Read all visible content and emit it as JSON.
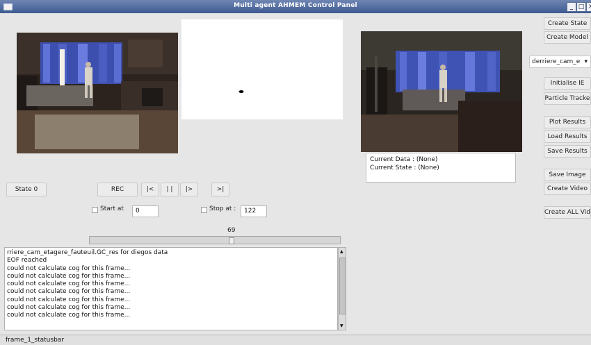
{
  "window": {
    "title": "Multi agent AHMEM Control Panel",
    "min_glyph": "_",
    "max_glyph": "□",
    "close_glyph": "✕"
  },
  "right_panel": {
    "create_state": "Create State",
    "create_model": "Create Model",
    "camera_select_value": "derriere_cam_e",
    "initialise_ie": "Initialise IE",
    "particle_tracker": "Particle Tracke",
    "plot_results": "Plot Results",
    "load_results": "Load Results",
    "save_results": "Save Results",
    "save_image": "Save Image",
    "create_video": "Create Video",
    "create_all_videos": "Create ALL Vid"
  },
  "info": {
    "current_data": "Current Data : (None)",
    "current_state": "Current State : (None)"
  },
  "controls": {
    "state": "State 0",
    "rec": "REC",
    "first": "|<",
    "pause": "| |",
    "play": "|>",
    "last": ">|",
    "start_at_label": "Start at",
    "start_at_value": "0",
    "stop_at_label": "Stop at :",
    "stop_at_value": "122"
  },
  "slider": {
    "value_text": "69",
    "value": 69,
    "max": 122
  },
  "log_lines": [
    "rriere_cam_etagere_fauteuil.GC_res for diegos data",
    "EOF reached",
    "could not calculate cog for this frame...",
    "could not calculate cog for this frame...",
    "could not calculate cog for this frame...",
    "could not calculate cog for this frame...",
    "could not calculate cog for this frame...",
    "could not calculate cog for this frame...",
    "could not calculate cog for this frame..."
  ],
  "statusbar": {
    "text": "frame_1_statusbar"
  }
}
